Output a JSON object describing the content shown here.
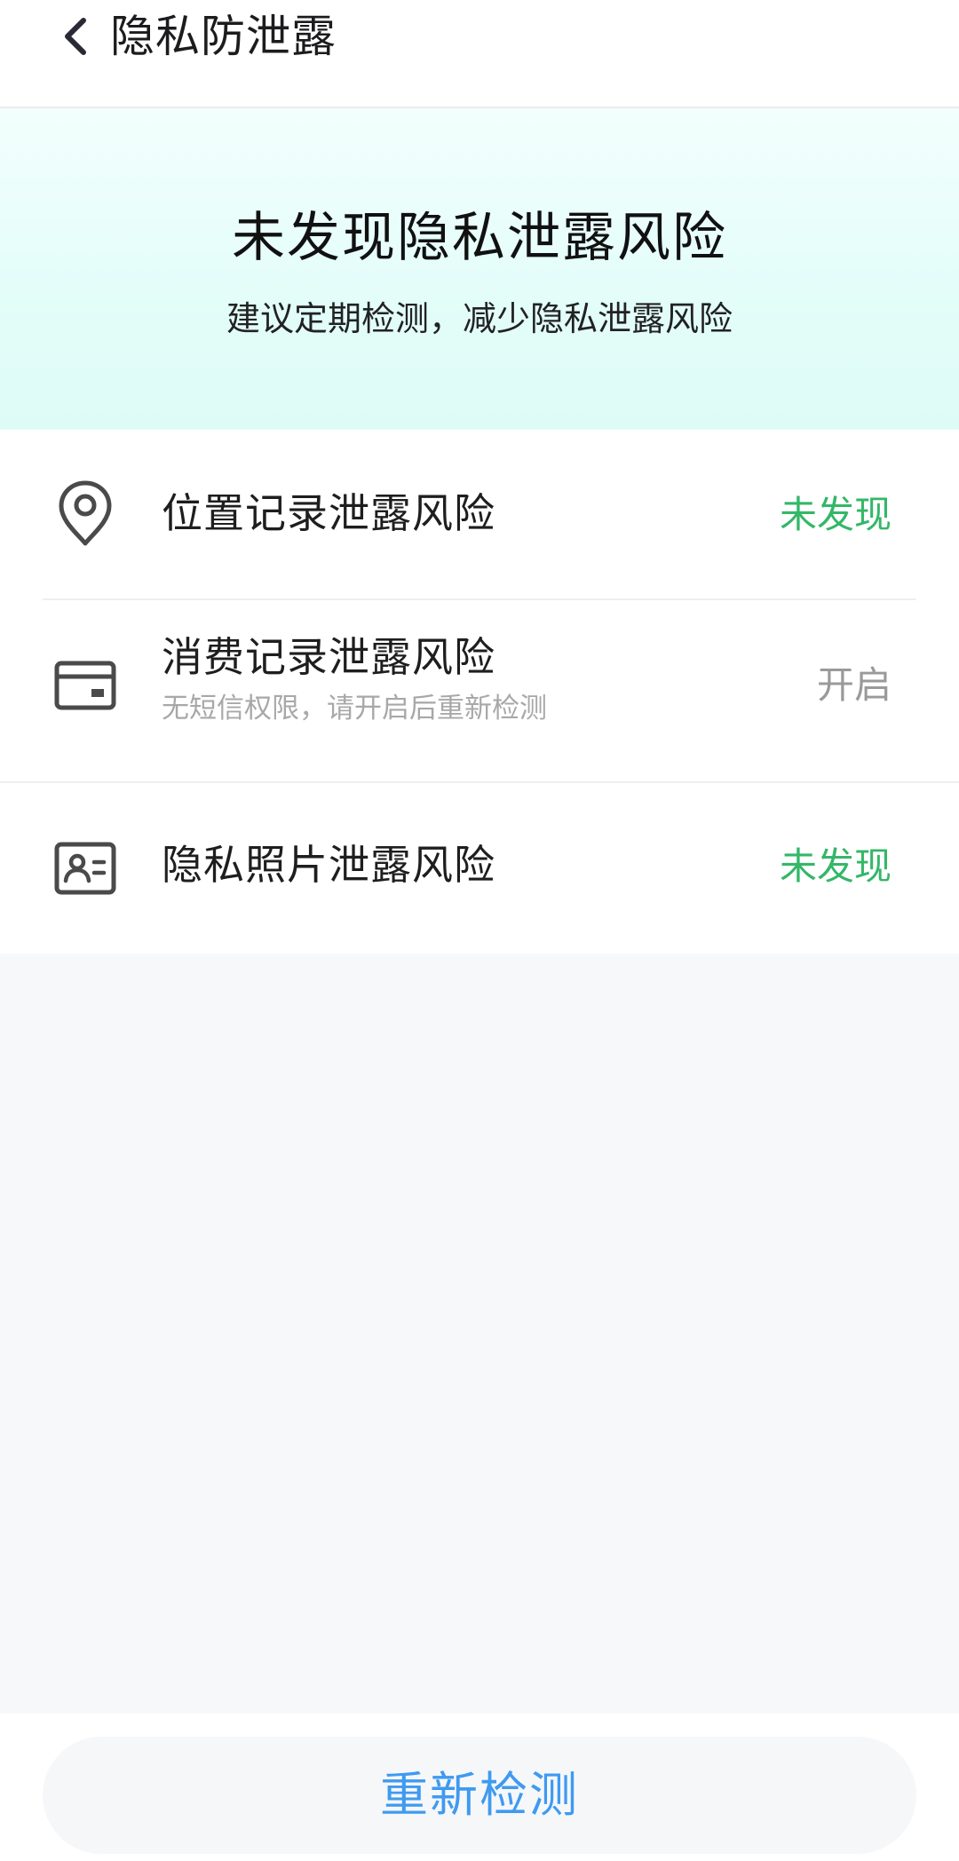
{
  "header": {
    "back_icon": "chevron-left-icon",
    "title": "隐私防泄露"
  },
  "banner": {
    "title": "未发现隐私泄露风险",
    "subtitle": "建议定期检测，减少隐私泄露风险"
  },
  "items": [
    {
      "icon": "location-pin-icon",
      "title": "位置记录泄露风险",
      "subtitle": "",
      "status": "未发现"
    },
    {
      "icon": "credit-card-icon",
      "title": "消费记录泄露风险",
      "subtitle": "无短信权限，请开启后重新检测",
      "status": "开启"
    },
    {
      "icon": "id-card-icon",
      "title": "隐私照片泄露风险",
      "subtitle": "",
      "status": "未发现"
    }
  ],
  "footer": {
    "recheck_label": "重新检测"
  },
  "colors": {
    "accent_blue": "#3f9af0",
    "status_green": "#34b768",
    "status_gray": "#9a9a9a",
    "banner_tint": "#e3fdf9"
  }
}
